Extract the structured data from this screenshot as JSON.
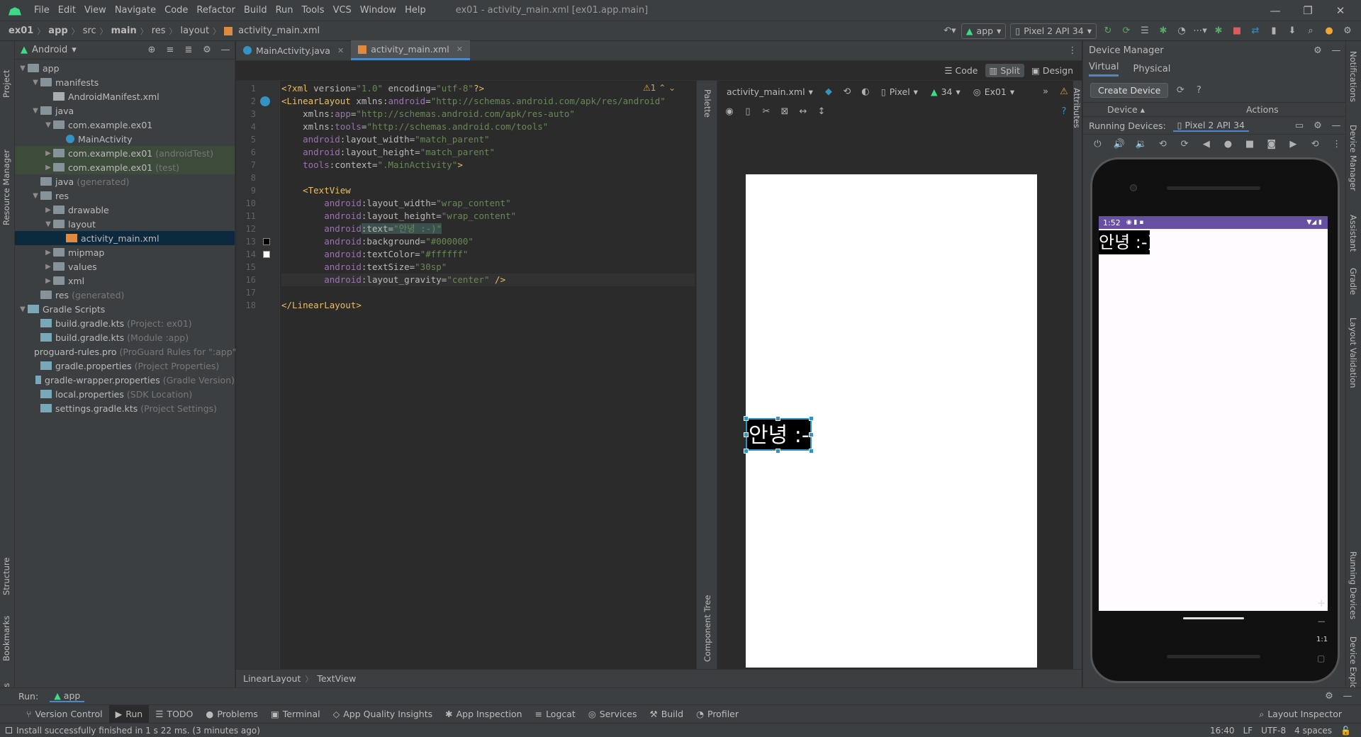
{
  "menu": {
    "items": [
      "File",
      "Edit",
      "View",
      "Navigate",
      "Code",
      "Refactor",
      "Build",
      "Run",
      "Tools",
      "VCS",
      "Window",
      "Help"
    ],
    "window_title": "ex01 - activity_main.xml [ex01.app.main]"
  },
  "nav": {
    "crumbs": [
      "ex01",
      "app",
      "src",
      "main",
      "res",
      "layout",
      "activity_main.xml"
    ],
    "run_config": "app",
    "device": "Pixel 2 API 34"
  },
  "project": {
    "view_mode": "Android",
    "tree": [
      {
        "label": "app",
        "depth": 0,
        "arrow": "down",
        "icon": "folder",
        "extra": ""
      },
      {
        "label": "manifests",
        "depth": 1,
        "arrow": "down",
        "icon": "folder",
        "extra": ""
      },
      {
        "label": "AndroidManifest.xml",
        "depth": 2,
        "arrow": "",
        "icon": "file",
        "extra": ""
      },
      {
        "label": "java",
        "depth": 1,
        "arrow": "down",
        "icon": "folder",
        "extra": ""
      },
      {
        "label": "com.example.ex01",
        "depth": 2,
        "arrow": "down",
        "icon": "folder",
        "extra": ""
      },
      {
        "label": "MainActivity",
        "depth": 3,
        "arrow": "",
        "icon": "class",
        "extra": ""
      },
      {
        "label": "com.example.ex01",
        "depth": 2,
        "arrow": "right",
        "icon": "folder",
        "extra": "(androidTest)",
        "green": true
      },
      {
        "label": "com.example.ex01",
        "depth": 2,
        "arrow": "right",
        "icon": "folder",
        "extra": "(test)",
        "green": true
      },
      {
        "label": "java",
        "depth": 1,
        "arrow": "",
        "icon": "folder",
        "extra": "(generated)"
      },
      {
        "label": "res",
        "depth": 1,
        "arrow": "down",
        "icon": "folder",
        "extra": ""
      },
      {
        "label": "drawable",
        "depth": 2,
        "arrow": "right",
        "icon": "folder",
        "extra": ""
      },
      {
        "label": "layout",
        "depth": 2,
        "arrow": "down",
        "icon": "folder",
        "extra": ""
      },
      {
        "label": "activity_main.xml",
        "depth": 3,
        "arrow": "",
        "icon": "xml",
        "extra": "",
        "selected": true
      },
      {
        "label": "mipmap",
        "depth": 2,
        "arrow": "right",
        "icon": "folder",
        "extra": ""
      },
      {
        "label": "values",
        "depth": 2,
        "arrow": "right",
        "icon": "folder",
        "extra": ""
      },
      {
        "label": "xml",
        "depth": 2,
        "arrow": "right",
        "icon": "folder",
        "extra": ""
      },
      {
        "label": "res",
        "depth": 1,
        "arrow": "",
        "icon": "folder",
        "extra": "(generated)"
      },
      {
        "label": "Gradle Scripts",
        "depth": 0,
        "arrow": "down",
        "icon": "gradle",
        "extra": ""
      },
      {
        "label": "build.gradle.kts",
        "depth": 1,
        "arrow": "",
        "icon": "gradle",
        "extra": "(Project: ex01)"
      },
      {
        "label": "build.gradle.kts",
        "depth": 1,
        "arrow": "",
        "icon": "gradle",
        "extra": "(Module :app)"
      },
      {
        "label": "proguard-rules.pro",
        "depth": 1,
        "arrow": "",
        "icon": "file",
        "extra": "(ProGuard Rules for \":app\")"
      },
      {
        "label": "gradle.properties",
        "depth": 1,
        "arrow": "",
        "icon": "gradle",
        "extra": "(Project Properties)"
      },
      {
        "label": "gradle-wrapper.properties",
        "depth": 1,
        "arrow": "",
        "icon": "gradle",
        "extra": "(Gradle Version)"
      },
      {
        "label": "local.properties",
        "depth": 1,
        "arrow": "",
        "icon": "gradle",
        "extra": "(SDK Location)"
      },
      {
        "label": "settings.gradle.kts",
        "depth": 1,
        "arrow": "",
        "icon": "gradle",
        "extra": "(Project Settings)"
      }
    ]
  },
  "left_strip": {
    "project": "Project",
    "resource_manager": "Resource Manager",
    "structure": "Structure",
    "bookmarks": "Bookmarks",
    "build_variants": "Build Variants"
  },
  "right_strip": {
    "notifications": "Notifications",
    "device_manager": "Device Manager",
    "assistant": "Assistant",
    "gradle": "Gradle",
    "layout_validation": "Layout Validation",
    "running_devices": "Running Devices",
    "device_explorer": "Device Explorer"
  },
  "editor": {
    "tabs": [
      {
        "label": "MainActivity.java",
        "active": false
      },
      {
        "label": "activity_main.xml",
        "active": true
      }
    ],
    "modes": {
      "code": "Code",
      "split": "Split",
      "design": "Design"
    },
    "warning_count": "1",
    "lines": [
      [
        [
          "tag",
          "<?xml "
        ],
        [
          "attr",
          "version="
        ],
        [
          "val",
          "\"1.0\" "
        ],
        [
          "attr",
          "encoding="
        ],
        [
          "val",
          "\"utf-8\""
        ],
        [
          "tag",
          "?>"
        ]
      ],
      [
        [
          "tag",
          "<LinearLayout "
        ],
        [
          "attr",
          "xmlns:"
        ],
        [
          "ns",
          "android"
        ],
        [
          "attr",
          "="
        ],
        [
          "val",
          "\"http://schemas.android.com/apk/res/android\""
        ]
      ],
      [
        [
          "attr",
          "    xmlns:"
        ],
        [
          "ns",
          "app"
        ],
        [
          "attr",
          "="
        ],
        [
          "val",
          "\"http://schemas.android.com/apk/res-auto\""
        ]
      ],
      [
        [
          "attr",
          "    xmlns:"
        ],
        [
          "ns",
          "tools"
        ],
        [
          "attr",
          "="
        ],
        [
          "val",
          "\"http://schemas.android.com/tools\""
        ]
      ],
      [
        [
          "ns",
          "    android"
        ],
        [
          "attr",
          ":layout_width="
        ],
        [
          "val",
          "\"match_parent\""
        ]
      ],
      [
        [
          "ns",
          "    android"
        ],
        [
          "attr",
          ":layout_height="
        ],
        [
          "val",
          "\"match_parent\""
        ]
      ],
      [
        [
          "ns",
          "    tools"
        ],
        [
          "attr",
          ":context="
        ],
        [
          "val",
          "\".MainActivity\""
        ],
        [
          "tag",
          ">"
        ]
      ],
      [],
      [
        [
          "tag",
          "    <TextView"
        ]
      ],
      [
        [
          "ns",
          "        android"
        ],
        [
          "attr",
          ":layout_width="
        ],
        [
          "val",
          "\"wrap_content\""
        ]
      ],
      [
        [
          "ns",
          "        android"
        ],
        [
          "attr",
          ":layout_height="
        ],
        [
          "val",
          "\"wrap_content\""
        ]
      ],
      [
        [
          "ns",
          "        android"
        ],
        [
          "attr",
          ":text="
        ],
        [
          "val",
          "\"안녕 :-)\""
        ]
      ],
      [
        [
          "ns",
          "        android"
        ],
        [
          "attr",
          ":background="
        ],
        [
          "val",
          "\"#000000\""
        ]
      ],
      [
        [
          "ns",
          "        android"
        ],
        [
          "attr",
          ":textColor="
        ],
        [
          "val",
          "\"#ffffff\""
        ]
      ],
      [
        [
          "ns",
          "        android"
        ],
        [
          "attr",
          ":textSize="
        ],
        [
          "val",
          "\"30sp\""
        ]
      ],
      [
        [
          "ns",
          "        android"
        ],
        [
          "attr",
          ":layout_gravity="
        ],
        [
          "val",
          "\"center\""
        ],
        [
          "tag",
          " />"
        ]
      ],
      [],
      [
        [
          "tag",
          "</LinearLayout>"
        ]
      ]
    ],
    "breadcrumb": [
      "LinearLayout",
      "TextView"
    ]
  },
  "design": {
    "file": "activity_main.xml",
    "device": "Pixel",
    "api": "34",
    "theme": "Ex01",
    "palette_label": "Palette",
    "component_tree_label": "Component Tree",
    "attributes_label": "Attributes",
    "textview_text": "안녕 :-)"
  },
  "device_manager": {
    "title": "Device Manager",
    "tabs": [
      "Virtual",
      "Physical"
    ],
    "create_button": "Create Device",
    "col_device": "Device",
    "col_actions": "Actions",
    "running_label": "Running Devices:",
    "running_device": "Pixel 2 API 34",
    "status_time": "1:52",
    "screen_text": "안녕 :-)",
    "zoom_label": "1:1"
  },
  "run": {
    "label": "Run:",
    "config": "app"
  },
  "bottom_tools": [
    "Version Control",
    "Run",
    "TODO",
    "Problems",
    "Terminal",
    "App Quality Insights",
    "App Inspection",
    "Logcat",
    "Services",
    "Build",
    "Profiler"
  ],
  "layout_inspector": "Layout Inspector",
  "status": {
    "message": "Install successfully finished in 1 s 22 ms. (3 minutes ago)",
    "position": "16:40",
    "line_sep": "LF",
    "encoding": "UTF-8",
    "indent": "4 spaces"
  }
}
